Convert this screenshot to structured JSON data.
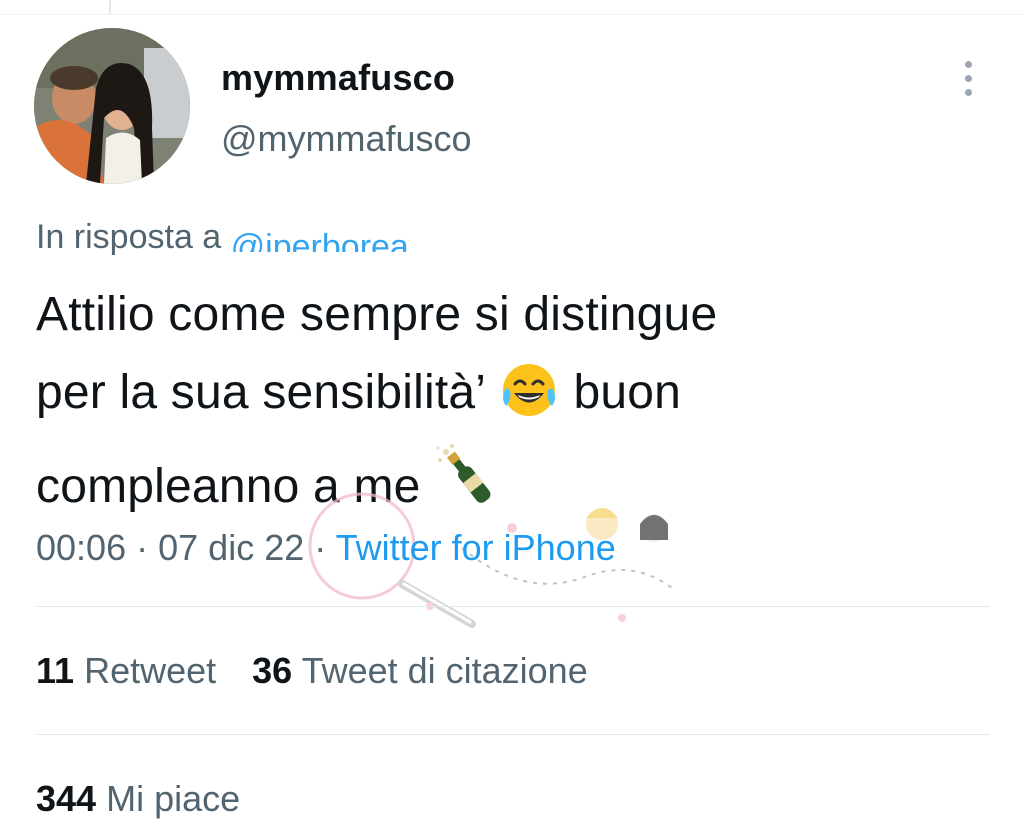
{
  "profile": {
    "display_name": "mymmafusco",
    "handle": "@mymmafusco"
  },
  "reply": {
    "prefix": "In risposta a",
    "target": "@iperborea_"
  },
  "tweet": {
    "line1": "Attilio come sempre si distingue",
    "line2a": "per la sua sensibilità’",
    "line2b": "buon",
    "line3": "compleanno a me"
  },
  "meta": {
    "time": "00:06",
    "separator": "·",
    "date": "07 dic 22",
    "source": "Twitter for iPhone"
  },
  "stats": {
    "retweets_count": "11",
    "retweets_label": "Retweet",
    "quotes_count": "36",
    "quotes_label": "Tweet di citazione",
    "likes_count": "344",
    "likes_label": "Mi piace"
  },
  "icons": {
    "more": "more-vertical-icon",
    "emoji1": "face-with-tears-of-joy-icon",
    "emoji2": "champagne-bottle-icon"
  },
  "colors": {
    "link": "#1d9bf0",
    "text": "#0f1419",
    "muted": "#536471"
  }
}
